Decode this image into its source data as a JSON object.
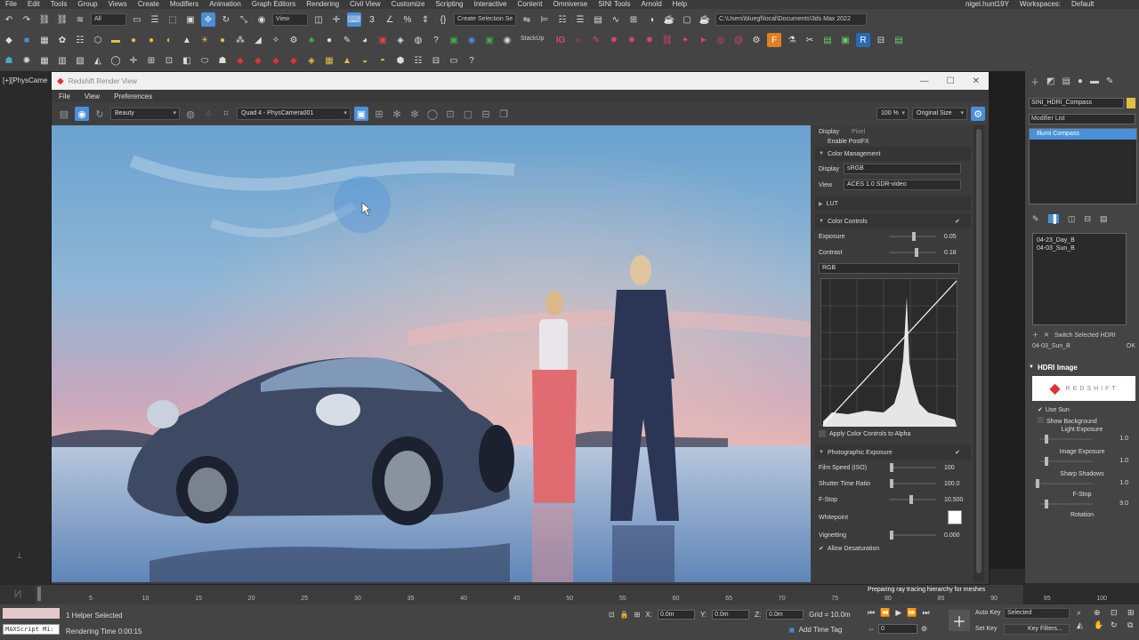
{
  "menubar": {
    "items": [
      "File",
      "Edit",
      "Tools",
      "Group",
      "Views",
      "Create",
      "Modifiers",
      "Animation",
      "Graph Editors",
      "Rendering",
      "Civil View",
      "Customize",
      "Scripting",
      "Interactive",
      "Content",
      "Omniverse",
      "SINI Tools",
      "Arnold",
      "Help"
    ],
    "user": "nigel.hunt19Y",
    "workspaces_label": "Workspaces:",
    "workspace_value": "Default"
  },
  "toolbar": {
    "selection_filter": "All",
    "view_dropdown": "View",
    "create_selection_set": "Create Selection Se",
    "project_path": "C:\\Users\\bluegf\\local\\Documents\\3ds Max 2022",
    "stackup_label": "StackUp",
    "colors": {
      "accent_pink": "#e0407a",
      "accent_blue": "#4a90d9"
    }
  },
  "left_viewport": {
    "label": "[+][PhysCame"
  },
  "render_view": {
    "title": "Redshift Render View",
    "menu": [
      "File",
      "View",
      "Preferences"
    ],
    "aov_dropdown": "Beauty",
    "camera_dropdown": "Quad 4 - PhysCamera001",
    "zoom": "100 %",
    "size_mode": "Original Size"
  },
  "side_panel": {
    "tabs": [
      "Display",
      "Pixel"
    ],
    "enable_postfx": "Enable PostFX",
    "color_management": {
      "header": "Color Management",
      "display_label": "Display",
      "display_value": "sRGB",
      "view_label": "View",
      "view_value": "ACES 1.0 SDR-video"
    },
    "lut_header": "LUT",
    "color_controls": {
      "header": "Color Controls",
      "exposure_label": "Exposure",
      "exposure_value": "0.05",
      "exposure_level": 0.52,
      "contrast_label": "Contrast",
      "contrast_value": "0.18",
      "contrast_level": 0.59,
      "channel": "RGB",
      "apply_alpha": "Apply Color Controls to Alpha"
    },
    "photographic": {
      "header": "Photographic Exposure",
      "film_speed_label": "Film Speed (ISO)",
      "film_speed_value": "100",
      "shutter_label": "Shutter Time Ratio",
      "shutter_value": "100.0",
      "fstop_label": "F-Stop",
      "fstop_value": "10.500",
      "whitepoint_label": "Whitepoint",
      "vignetting_label": "Vignetting",
      "vignetting_value": "0.000",
      "desat_label": "Allow Desaturation"
    }
  },
  "command_panel": {
    "object_name": "SINI_HDRI_Compass",
    "modifier_list": "Modifier List",
    "stack_item": "Illumi Compass",
    "hdri_list": [
      "04-23_Day_B",
      "04-03_Sun_B"
    ],
    "switch_label": "Switch Selected HDRI",
    "selected_hdri": "04-03_Sun_B",
    "ok_label": "OK",
    "hdri_image_header": "HDRI Image",
    "logo_text": "REDSHIFT",
    "use_sun": "Use Sun",
    "show_background": "Show Background",
    "light_exposure": "Light Exposure",
    "light_exposure_value": "1.0",
    "image_exposure": "Image Exposure",
    "image_exposure_value": "1.0",
    "sharp_shadows": "Sharp Shadows",
    "sharp_shadows_value": "1.0",
    "fstop": "F-Stop",
    "fstop_value": "9.0",
    "rotation": "Rotation"
  },
  "timeline": {
    "ticks": [
      "5",
      "10",
      "15",
      "20",
      "25",
      "30",
      "35",
      "40",
      "45",
      "50",
      "55",
      "60",
      "65",
      "70",
      "75",
      "80",
      "85",
      "90",
      "95",
      "100"
    ],
    "frame_display": "0 / 100",
    "progress_message": "Preparing ray tracing hierarchy for meshes"
  },
  "status": {
    "maxscript": "MAXScript Mi:",
    "selection": "1 Helper Selected",
    "rendering_time": "Rendering Time  0:00:15",
    "x_label": "X:",
    "x_value": "0.0m",
    "y_label": "Y:",
    "y_value": "0.0m",
    "z_label": "Z:",
    "z_value": "0.0m",
    "grid": "Grid = 10.0m",
    "add_time_tag": "Add Time Tag",
    "frame_value": "0",
    "auto_key": "Auto Key",
    "selected": "Selected",
    "set_key": "Set Key",
    "key_filters": "Key Filters..."
  }
}
